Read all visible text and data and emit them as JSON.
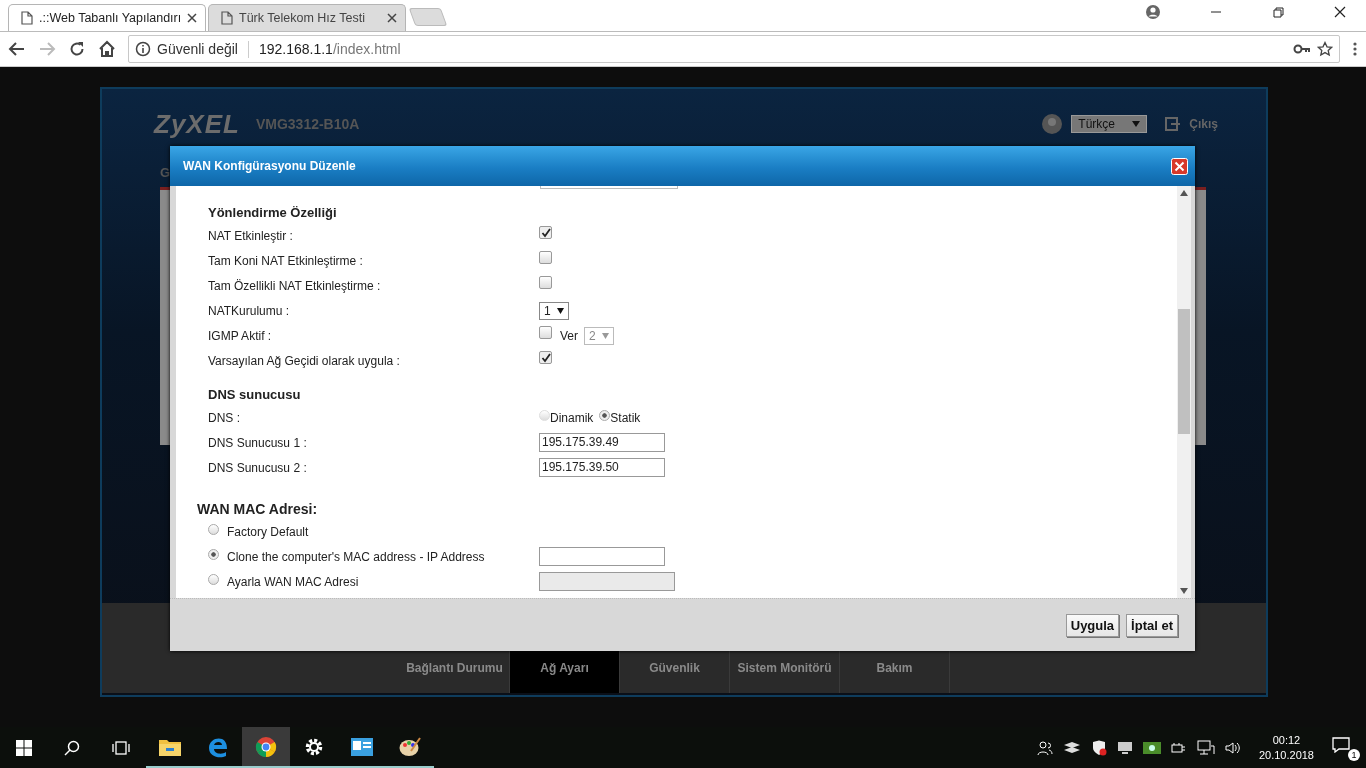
{
  "browser": {
    "tabs": [
      {
        "title": ".::Web Tabanlı Yapılandırı",
        "selected": true
      },
      {
        "title": "Türk Telekom Hız Testi",
        "selected": false
      }
    ],
    "security": "Güvenli değil",
    "url_host": "192.168.1.1",
    "url_path": "/index.html"
  },
  "router": {
    "brand": "ZyXEL",
    "model": "VMG3312-B10A",
    "language": "Türkçe",
    "logout": "Çıkış",
    "side_text": "G",
    "nav": [
      {
        "label": "Bağlantı Durumu",
        "selected": false
      },
      {
        "label": "Ağ Ayarı",
        "selected": true
      },
      {
        "label": "Güvenlik",
        "selected": false
      },
      {
        "label": "Sistem Monitörü",
        "selected": false
      },
      {
        "label": "Bakım",
        "selected": false
      }
    ]
  },
  "dialog": {
    "title": "WAN Konfigürasyonu Düzenle",
    "sections": [
      {
        "heading": "Yönlendirme Özelliği",
        "rows": [
          {
            "kind": "checkbox",
            "label": "NAT Etkinleştir :",
            "checked": true
          },
          {
            "kind": "checkbox",
            "label": "Tam Koni NAT Etkinleştirme :",
            "checked": false
          },
          {
            "kind": "checkbox",
            "label": "Tam Özellikli NAT Etkinleştirme :",
            "checked": false
          },
          {
            "kind": "select",
            "label": "NATKurulumu :",
            "value": "1"
          },
          {
            "kind": "checkbox_select",
            "label": "IGMP Aktif :",
            "checked": false,
            "select_label": "Ver",
            "value": "2"
          },
          {
            "kind": "checkbox",
            "label": "Varsayılan Ağ Geçidi olarak uygula :",
            "checked": true
          }
        ]
      },
      {
        "heading": "DNS sunucusu",
        "rows": [
          {
            "kind": "radio",
            "label": "DNS :",
            "options": [
              {
                "label": "Dinamik",
                "selected": false
              },
              {
                "label": "Statik",
                "selected": true
              }
            ]
          },
          {
            "kind": "text",
            "label": "DNS Sunucusu 1 :",
            "value": "195.175.39.49"
          },
          {
            "kind": "text",
            "label": "DNS Sunucusu 2 :",
            "value": "195.175.39.50"
          }
        ]
      }
    ],
    "mac": {
      "heading": "WAN MAC Adresi:",
      "options": [
        {
          "kind": "plain",
          "label": "Factory Default",
          "selected": false
        },
        {
          "kind": "field",
          "label": "Clone the computer's MAC address - IP Address",
          "selected": true,
          "field_disabled": false
        },
        {
          "kind": "field",
          "label": "Ayarla WAN MAC Adresi",
          "selected": false,
          "field_disabled": true
        }
      ]
    },
    "buttons": [
      "Uygula",
      "İptal et"
    ]
  },
  "taskbar": {
    "apps": [
      {
        "kind": "explorer",
        "selected": false
      },
      {
        "kind": "edge",
        "selected": false
      },
      {
        "kind": "chrome",
        "selected": true
      },
      {
        "kind": "settings",
        "selected": false
      },
      {
        "kind": "contacts",
        "selected": false
      },
      {
        "kind": "paint",
        "selected": false
      }
    ],
    "time": "00:12",
    "date": "20.10.2018",
    "notifications": "1"
  }
}
